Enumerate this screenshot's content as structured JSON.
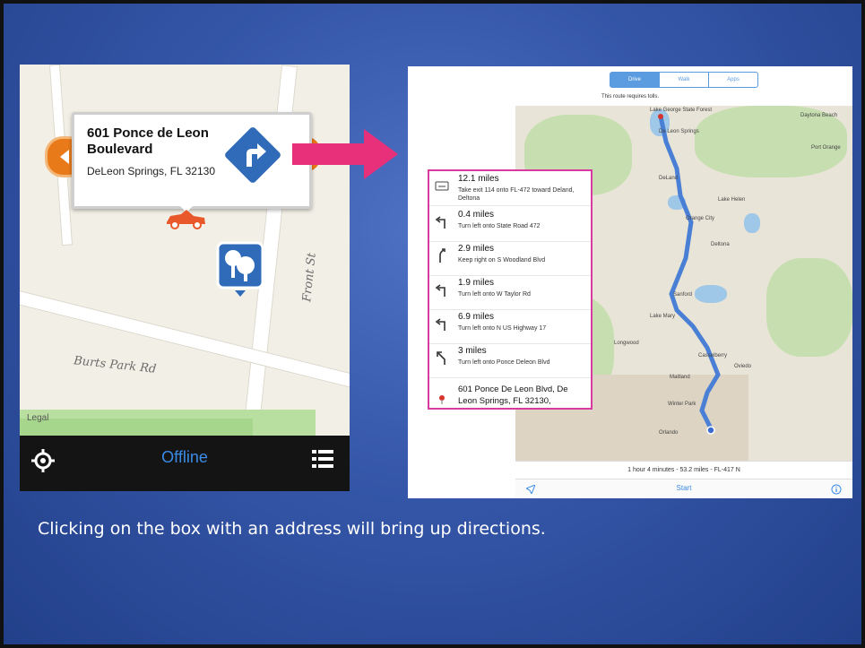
{
  "left_phone": {
    "callout_title": "601 Ponce de Leon Boulevard",
    "callout_address": "DeLeon Springs, FL 32130",
    "street_front": "Front St",
    "street_burts": "Burts Park Rd",
    "legal_label": "Legal",
    "offline_label": "Offline",
    "icons": [
      "directions-turn-icon",
      "car-icon",
      "park-icon",
      "locate-icon",
      "list-icon"
    ]
  },
  "right_ipad": {
    "segments": [
      "Drive",
      "Walk",
      "Apps"
    ],
    "tolls_notice": "This route requires tolls.",
    "summary": "1 hour 4 minutes - 53.2 miles - FL-417 N",
    "start_label": "Start",
    "cities": [
      "Lake George State Forest",
      "De Leon Springs",
      "DeLand",
      "Deltona",
      "Orange City",
      "Lake Helen",
      "Sanford",
      "Lake Mary",
      "Oviedo",
      "Winter Park",
      "Orlando",
      "Maitland",
      "Casselberry",
      "Longwood",
      "Port Orange",
      "Daytona Beach"
    ]
  },
  "directions": [
    {
      "distance": "12.1 miles",
      "instruction": "Take exit 114 onto FL-472 toward Deland, Deltona",
      "icon": "exit-icon"
    },
    {
      "distance": "0.4 miles",
      "instruction": "Turn left onto State Road 472",
      "icon": "turn-left-icon"
    },
    {
      "distance": "2.9 miles",
      "instruction": "Keep right on S Woodland Blvd",
      "icon": "keep-right-icon"
    },
    {
      "distance": "1.9 miles",
      "instruction": "Turn left onto W Taylor Rd",
      "icon": "turn-left-icon"
    },
    {
      "distance": "6.9 miles",
      "instruction": "Turn left onto N US Highway 17",
      "icon": "turn-left-icon"
    },
    {
      "distance": "3 miles",
      "instruction": "Turn left onto Ponce Deleon Blvd",
      "icon": "slight-left-icon"
    }
  ],
  "destination": "601 Ponce De Leon Blvd, De Leon Springs, FL 32130,",
  "caption": "Clicking on the box with an address will bring up directions.",
  "colors": {
    "accent_blue": "#3a8be6",
    "arrow_pink": "#e8307a",
    "route_blue": "#4a7fd6",
    "orange": "#e87a1a"
  }
}
